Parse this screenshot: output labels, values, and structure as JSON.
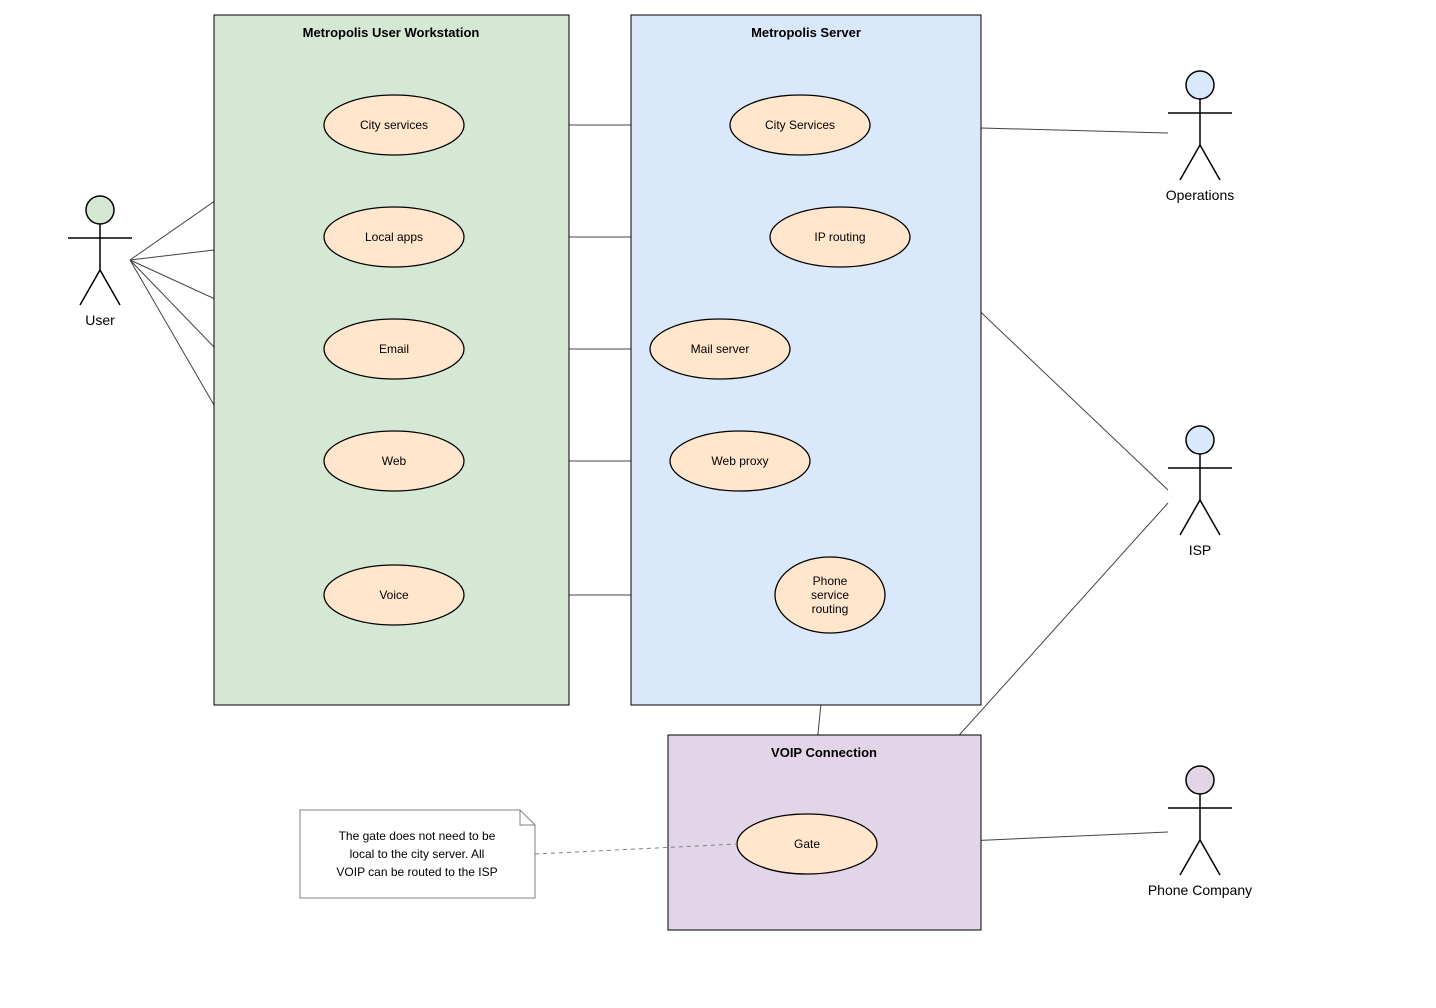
{
  "boundaries": {
    "workstation": "Metropolis User Workstation",
    "server": "Metropolis Server",
    "voip": "VOIP Connection"
  },
  "usecases": {
    "city_services_ws": "City services",
    "local_apps": "Local apps",
    "email": "Email",
    "web": "Web",
    "voice": "Voice",
    "city_services_srv": "City Services",
    "ip_routing": "IP routing",
    "mail_server": "Mail server",
    "web_proxy": "Web proxy",
    "phone_service_routing_l1": "Phone",
    "phone_service_routing_l2": "service",
    "phone_service_routing_l3": "routing",
    "gate": "Gate"
  },
  "actors": {
    "user": "User",
    "operations": "Operations",
    "isp": "ISP",
    "phone_company": "Phone Company"
  },
  "note": {
    "l1": "The gate does not need to be",
    "l2": "local to the city server.  All",
    "l3": "VOIP can be routed to the ISP"
  },
  "colors": {
    "workstation_fill": "#d5e8d4",
    "server_fill": "#dae8fc",
    "voip_fill": "#e1d5e7",
    "ellipse_fill": "#ffe6cc",
    "user_head": "#d5e8d4",
    "ops_head": "#dae8fc",
    "isp_head": "#dae8fc",
    "phone_head": "#e1d5e7",
    "note_fill": "#ffffff"
  }
}
